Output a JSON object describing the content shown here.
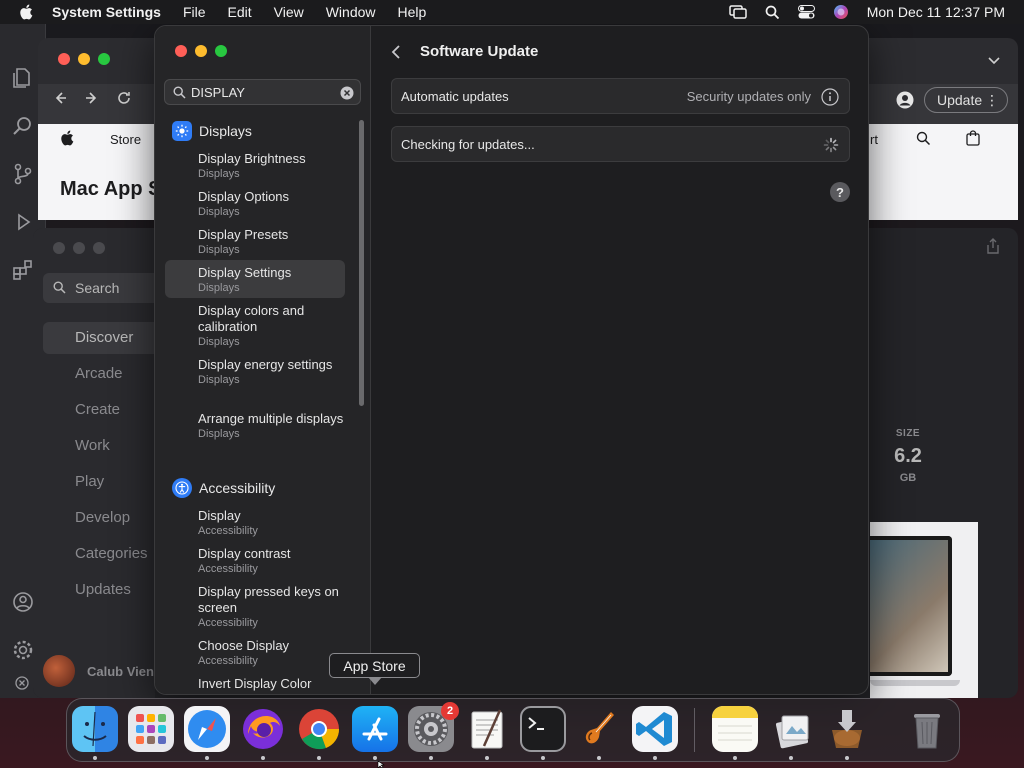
{
  "menubar": {
    "app_name": "System Settings",
    "items": [
      "File",
      "Edit",
      "View",
      "Window",
      "Help"
    ],
    "clock": "Mon Dec 11  12:37 PM"
  },
  "chrome": {
    "apple_nav_store": "Store",
    "page_heading": "Mac App S",
    "update_label": "Update",
    "nav_cart_partial": "rt"
  },
  "app_store": {
    "search_placeholder": "Search",
    "sidebar_items": [
      "Discover",
      "Arcade",
      "Create",
      "Work",
      "Play",
      "Develop",
      "Categories",
      "Updates"
    ],
    "user_name": "Calub Vien",
    "size_label": "SIZE",
    "size_value": "6.2",
    "size_unit": "GB"
  },
  "settings": {
    "search_value": "DISPLAY",
    "groups": [
      {
        "name": "Displays",
        "icon": "sun-icon",
        "color": "#2f7cf6",
        "results": [
          {
            "title": "Display Brightness",
            "subtitle": "Displays"
          },
          {
            "title": "Display Options",
            "subtitle": "Displays"
          },
          {
            "title": "Display Presets",
            "subtitle": "Displays"
          },
          {
            "title": "Display Settings",
            "subtitle": "Displays"
          },
          {
            "title": "Display colors and calibration",
            "subtitle": "Displays"
          },
          {
            "title": "Display energy settings",
            "subtitle": "Displays"
          },
          {
            "title": "Arrange multiple displays",
            "subtitle": "Displays"
          }
        ]
      },
      {
        "name": "Accessibility",
        "icon": "accessibility-icon",
        "color": "#2f7cf6",
        "results": [
          {
            "title": "Display",
            "subtitle": "Accessibility"
          },
          {
            "title": "Display contrast",
            "subtitle": "Accessibility"
          },
          {
            "title": "Display pressed keys on screen",
            "subtitle": "Accessibility"
          },
          {
            "title": "Choose Display",
            "subtitle": "Accessibility"
          },
          {
            "title": "Invert Display Color",
            "subtitle": ""
          }
        ]
      }
    ],
    "selected_result": "Display Settings",
    "page_title": "Software Update",
    "auto_updates_label": "Automatic updates",
    "auto_updates_value": "Security updates only",
    "checking_label": "Checking for updates...",
    "help_label": "?"
  },
  "tooltip": {
    "label": "App Store"
  },
  "dock": {
    "apps": [
      "Finder",
      "Launchpad",
      "Safari",
      "Firefox",
      "Chrome",
      "App Store",
      "System Settings",
      "TextEdit",
      "Terminal",
      "GarageBand",
      "Visual Studio Code",
      "Notes",
      "Preview",
      "Installer",
      "Trash"
    ],
    "settings_badge": "2"
  },
  "colors": {
    "accent": "#2f7cf6",
    "close": "#ff5f57",
    "minimize": "#febc2e",
    "zoom": "#28c840",
    "badge": "#e53935"
  }
}
